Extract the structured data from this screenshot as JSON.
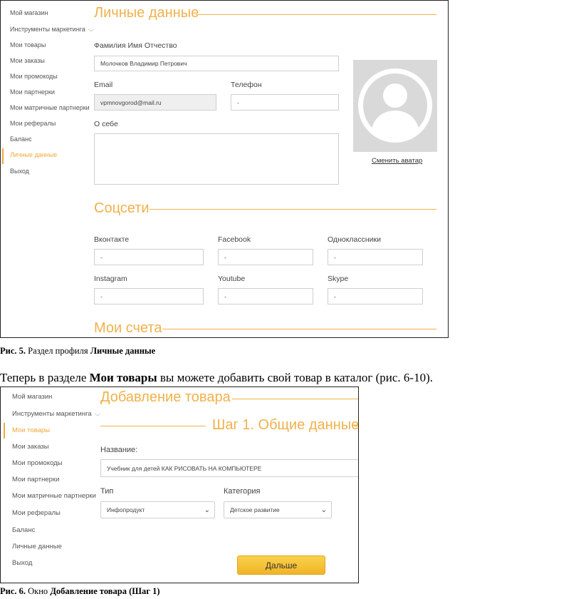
{
  "figure5": {
    "sidebar": [
      {
        "label": "Мой магазин"
      },
      {
        "label": "Инструменты маркетинга"
      },
      {
        "label": "Мои товары"
      },
      {
        "label": "Мои заказы"
      },
      {
        "label": "Мои промокоды"
      },
      {
        "label": "Мои партнерки"
      },
      {
        "label": "Мои матричные партнерки"
      },
      {
        "label": "Мои рефералы"
      },
      {
        "label": "Баланс"
      },
      {
        "label": "Личные данные"
      },
      {
        "label": "Выход"
      }
    ],
    "active_item": "Личные данные",
    "personal_title": "Личные данные",
    "fio_label": "Фамилия Имя Отчество",
    "fio_value": "Молочков Владимир Петрович",
    "email_label": "Email",
    "email_value": "vpmnovgorod@mail.ru",
    "phone_label": "Телефон",
    "phone_value": "-",
    "about_label": "О себе",
    "about_value": "",
    "avatar_link": "Сменить аватар",
    "social_title": "Соцсети",
    "social": [
      {
        "label": "Вконтакте",
        "value": "-"
      },
      {
        "label": "Facebook",
        "value": "-"
      },
      {
        "label": "Одноклассники",
        "value": "-"
      },
      {
        "label": "Instagram",
        "value": "-"
      },
      {
        "label": "Youtube",
        "value": "-"
      },
      {
        "label": "Skype",
        "value": "-"
      }
    ],
    "accounts_title": "Мои счета"
  },
  "caption5": {
    "prefix": "Рис. 5.",
    "text": " Раздел профиля ",
    "bold": "Личные данные"
  },
  "paragraph": {
    "before": "Теперь в разделе ",
    "bold": "Мои товары",
    "after": " вы можете добавить свой товар в каталог (рис. 6-10)."
  },
  "figure6": {
    "sidebar": [
      {
        "label": "Мой магазин"
      },
      {
        "label": "Инструменты маркетинга"
      },
      {
        "label": "Мои товары"
      },
      {
        "label": "Мои заказы"
      },
      {
        "label": "Мои промокоды"
      },
      {
        "label": "Мои партнерки"
      },
      {
        "label": "Мои матричные партнерки"
      },
      {
        "label": "Мои рефералы"
      },
      {
        "label": "Баланс"
      },
      {
        "label": "Личные данные"
      },
      {
        "label": "Выход"
      }
    ],
    "active_item": "Мои товары",
    "add_title": "Добавление товара",
    "step_title": "Шаг 1. Общие данные",
    "name_label": "Название:",
    "name_value": "Учебник для детей КАК РИСОВАТЬ НА КОМПЬЮТЕРЕ",
    "type_label": "Тип",
    "type_value": "Инфопродукт",
    "category_label": "Категория",
    "category_value": "Детское развитие",
    "next_button": "Дальше"
  },
  "caption6": {
    "prefix": "Рис. 6.",
    "text": " Окно ",
    "bold": "Добавление товара (Шаг 1)"
  },
  "colors": {
    "accent": "#f0b14a",
    "button": "#f4c238"
  }
}
